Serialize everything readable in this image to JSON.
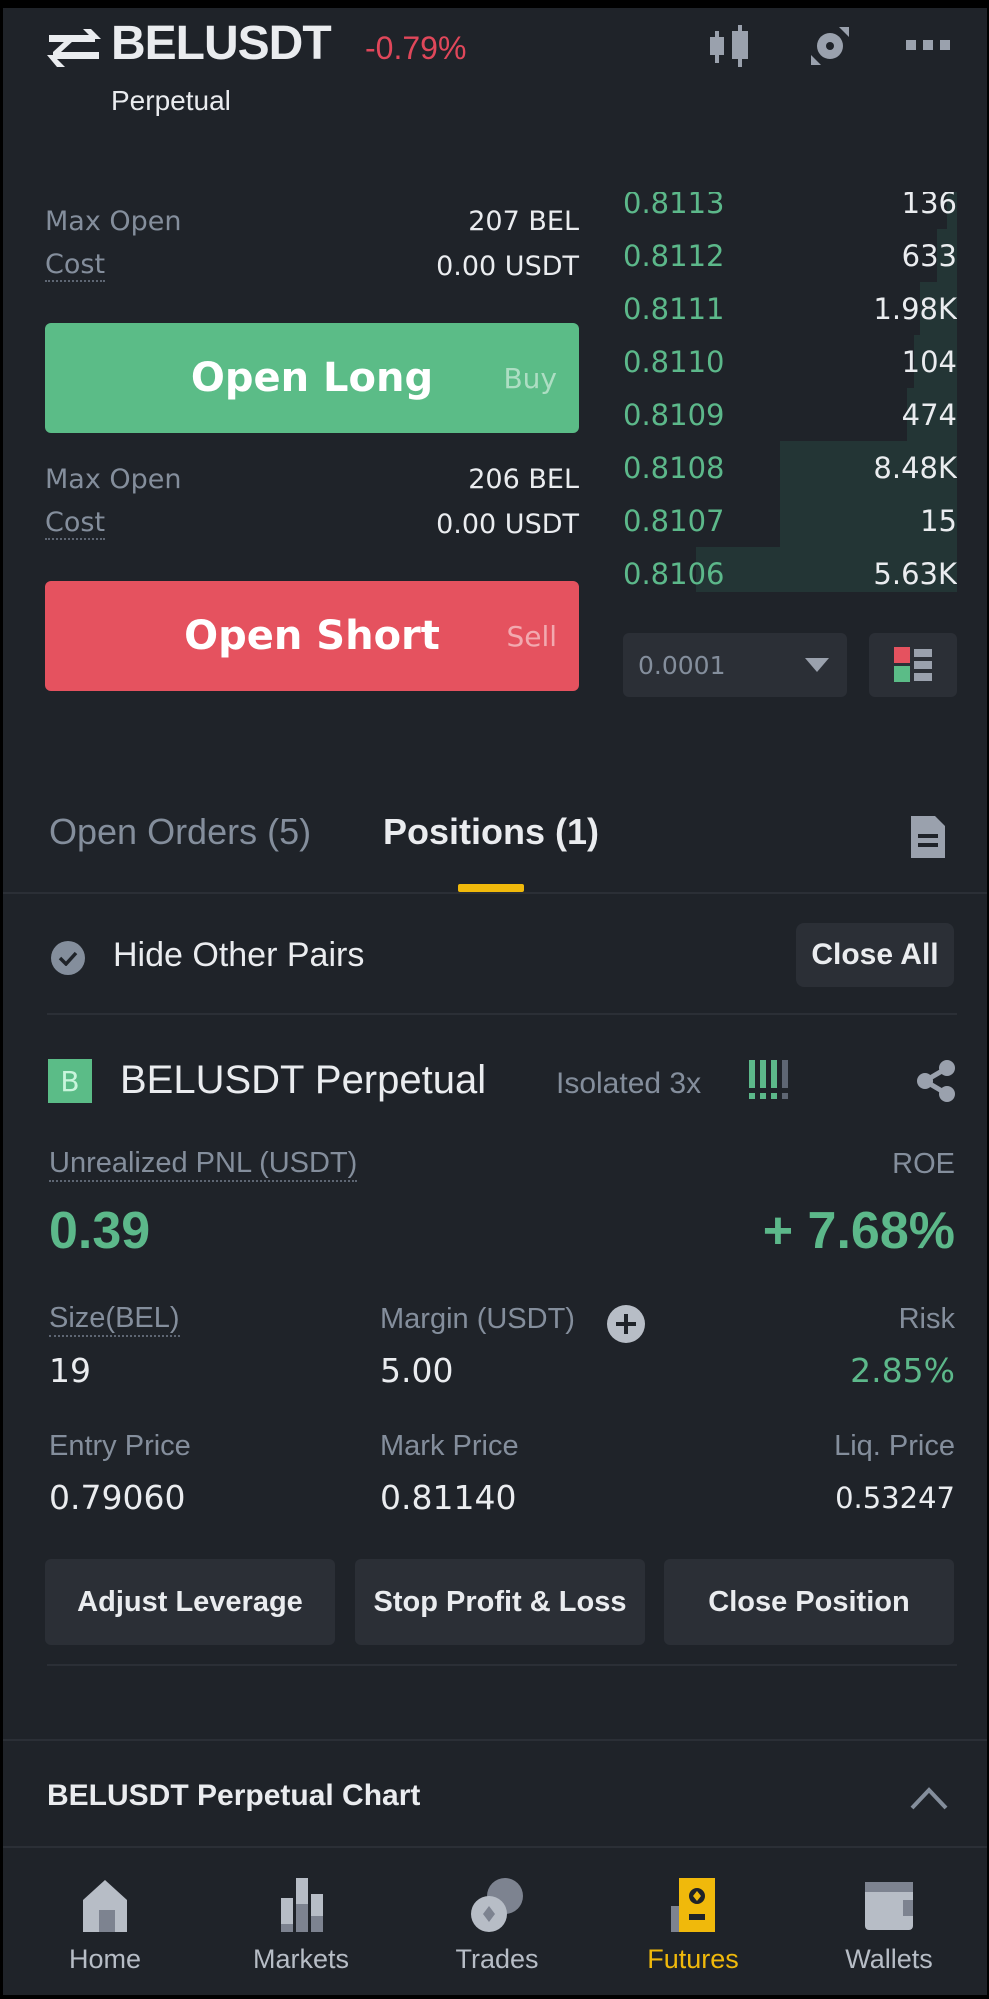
{
  "header": {
    "symbol": "BELUSDT",
    "change": "-0.79%",
    "contract_type": "Perpetual",
    "icons": [
      "swap-icon",
      "candlestick-chart-icon",
      "calculator-icon",
      "more-icon"
    ]
  },
  "order_form": {
    "long": {
      "max_open_label": "Max Open",
      "max_open_value": "207 BEL",
      "cost_label": "Cost",
      "cost_value": "0.00 USDT",
      "button_label": "Open Long",
      "button_side": "Buy"
    },
    "short": {
      "max_open_label": "Max Open",
      "max_open_value": "206 BEL",
      "cost_label": "Cost",
      "cost_value": "0.00 USDT",
      "button_label": "Open Short",
      "button_side": "Sell"
    }
  },
  "order_book": {
    "bids": [
      {
        "price": "0.8113",
        "qty": "136",
        "depth": 0.03
      },
      {
        "price": "0.8112",
        "qty": "633",
        "depth": 0.06
      },
      {
        "price": "0.8111",
        "qty": "1.98K",
        "depth": 0.11
      },
      {
        "price": "0.8110",
        "qty": "104",
        "depth": 0.13
      },
      {
        "price": "0.8109",
        "qty": "474",
        "depth": 0.15
      },
      {
        "price": "0.8108",
        "qty": "8.48K",
        "depth": 0.53
      },
      {
        "price": "0.8107",
        "qty": "15",
        "depth": 0.53
      },
      {
        "price": "0.8106",
        "qty": "5.63K",
        "depth": 0.78
      }
    ],
    "precision": "0.0001",
    "colors": {
      "bid": "#5cb88a",
      "ask": "#e0475a"
    }
  },
  "tabs": {
    "items": [
      {
        "label": "Open Orders (5)",
        "active": false
      },
      {
        "label": "Positions (1)",
        "active": true
      }
    ]
  },
  "filter": {
    "hide_other_pairs": "Hide Other Pairs",
    "hide_other_pairs_checked": true,
    "close_all": "Close All"
  },
  "position": {
    "badge": "B",
    "title": "BELUSDT Perpetual",
    "mode": "Isolated 3x",
    "risk_level": 3,
    "risk_level_max": 4,
    "pnl_label": "Unrealized PNL (USDT)",
    "pnl_value": "0.39",
    "roe_label": "ROE",
    "roe_value": "+ 7.68%",
    "size_label": "Size(BEL)",
    "size_value": "19",
    "margin_label": "Margin (USDT)",
    "margin_value": "5.00",
    "risk_label": "Risk",
    "risk_value": "2.85%",
    "entry_label": "Entry Price",
    "entry_value": "0.79060",
    "mark_label": "Mark Price",
    "mark_value": "0.81140",
    "liq_label": "Liq. Price",
    "liq_value": "0.53247",
    "actions": [
      "Adjust Leverage",
      "Stop Profit & Loss",
      "Close Position"
    ]
  },
  "chart_section": {
    "title": "BELUSDT Perpetual  Chart"
  },
  "bottom_nav": {
    "items": [
      {
        "label": "Home",
        "icon": "home-icon",
        "active": false
      },
      {
        "label": "Markets",
        "icon": "markets-icon",
        "active": false
      },
      {
        "label": "Trades",
        "icon": "trades-icon",
        "active": false
      },
      {
        "label": "Futures",
        "icon": "futures-icon",
        "active": true
      },
      {
        "label": "Wallets",
        "icon": "wallet-icon",
        "active": false
      }
    ]
  },
  "colors": {
    "background": "#1f2329",
    "panel": "#2b2f36",
    "green": "#5bbc87",
    "red": "#e5525f",
    "accent": "#f0b90b",
    "text_primary": "#eaecef",
    "text_secondary": "#848e9c"
  }
}
